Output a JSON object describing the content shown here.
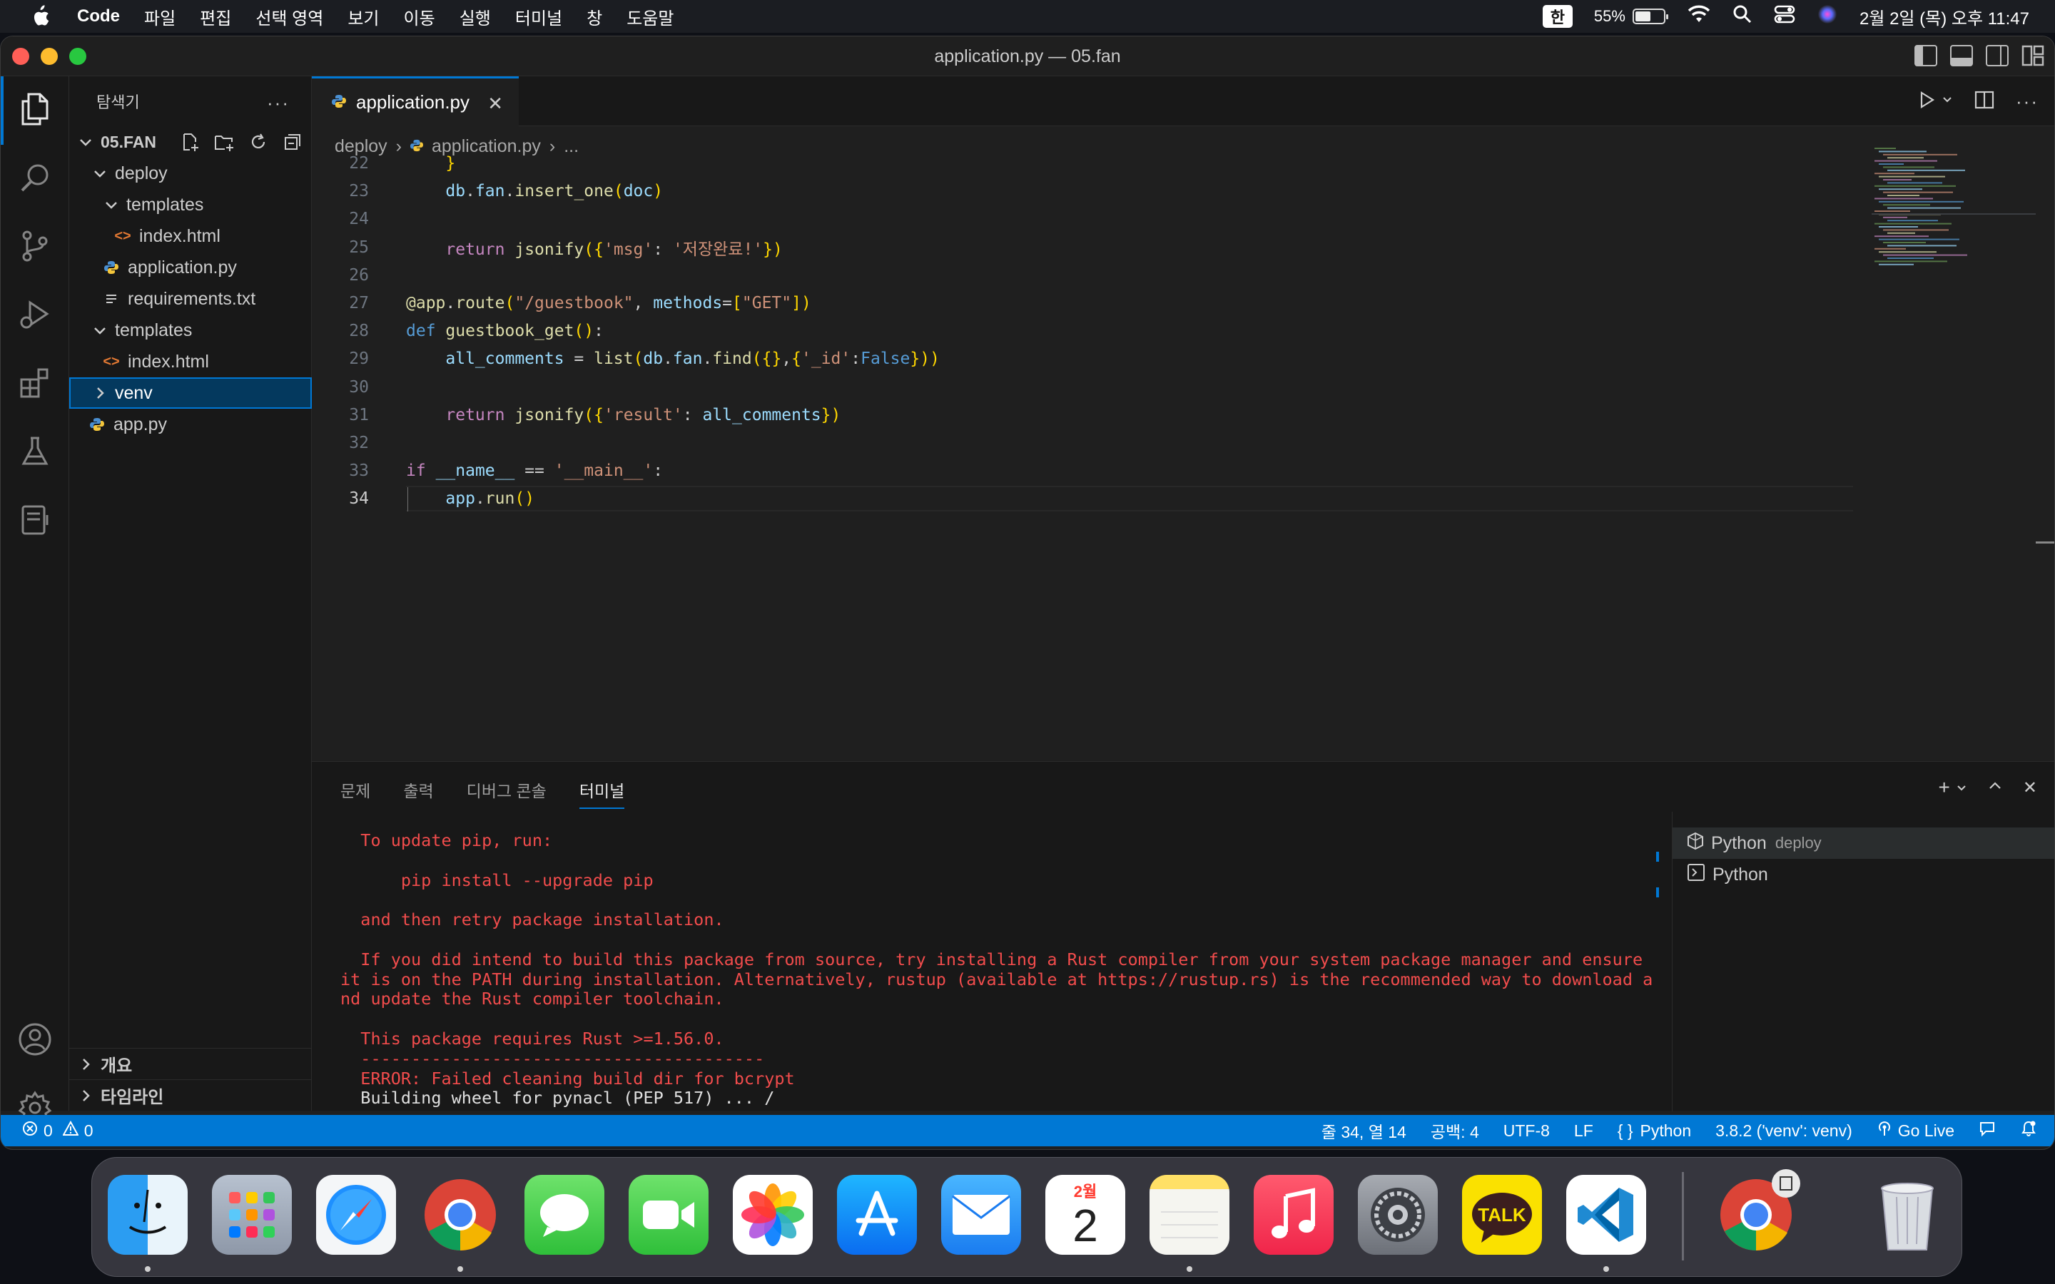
{
  "menubar": {
    "app_name": "Code",
    "menus": [
      "파일",
      "편집",
      "선택 영역",
      "보기",
      "이동",
      "실행",
      "터미널",
      "창",
      "도움말"
    ],
    "input_source": "한",
    "battery_percent": "55%",
    "battery_level": 0.55,
    "datetime": "2월 2일 (목) 오후 11:47"
  },
  "window": {
    "title": "application.py — 05.fan"
  },
  "sidebar": {
    "header": "탐색기",
    "more": "···",
    "root": "05.FAN",
    "tree": [
      {
        "label": "deploy",
        "type": "folder",
        "expanded": true
      },
      {
        "label": "templates",
        "type": "folder",
        "expanded": true
      },
      {
        "label": "index.html",
        "type": "html"
      },
      {
        "label": "application.py",
        "type": "python"
      },
      {
        "label": "requirements.txt",
        "type": "text"
      },
      {
        "label": "templates",
        "type": "folder",
        "expanded": true
      },
      {
        "label": "index.html",
        "type": "html"
      },
      {
        "label": "venv",
        "type": "folder",
        "expanded": false,
        "selected": true
      },
      {
        "label": "app.py",
        "type": "python"
      }
    ],
    "outline": "개요",
    "timeline": "타임라인"
  },
  "editor": {
    "tab_label": "application.py",
    "breadcrumb": [
      "deploy",
      "application.py",
      "..."
    ],
    "lines": [
      {
        "n": "22",
        "text": "    }"
      },
      {
        "n": "23",
        "text": "    db.fan.insert_one(doc)"
      },
      {
        "n": "24",
        "text": ""
      },
      {
        "n": "25",
        "text": "    return jsonify({'msg': '저장완료!'})"
      },
      {
        "n": "26",
        "text": ""
      },
      {
        "n": "27",
        "text": "@app.route(\"/guestbook\", methods=[\"GET\"])"
      },
      {
        "n": "28",
        "text": "def guestbook_get():"
      },
      {
        "n": "29",
        "text": "    all_comments = list(db.fan.find({},{'_id':False}))"
      },
      {
        "n": "30",
        "text": ""
      },
      {
        "n": "31",
        "text": "    return jsonify({'result': all_comments})"
      },
      {
        "n": "32",
        "text": ""
      },
      {
        "n": "33",
        "text": "if __name__ == '__main__':"
      },
      {
        "n": "34",
        "text": "    app.run()"
      }
    ]
  },
  "panel": {
    "tabs": [
      "문제",
      "출력",
      "디버그 콘솔",
      "터미널"
    ],
    "active_tab": "터미널",
    "terminal_lines": [
      {
        "text": "  To update pip, run:",
        "color": "red"
      },
      {
        "text": "",
        "color": "red"
      },
      {
        "text": "      pip install --upgrade pip",
        "color": "red"
      },
      {
        "text": "",
        "color": "red"
      },
      {
        "text": "  and then retry package installation.",
        "color": "red"
      },
      {
        "text": "",
        "color": "red"
      },
      {
        "text": "  If you did intend to build this package from source, try installing a Rust compiler from your system package manager and ensure",
        "color": "red"
      },
      {
        "text": "it is on the PATH during installation. Alternatively, rustup (available at https://rustup.rs) is the recommended way to download a",
        "color": "red"
      },
      {
        "text": "nd update the Rust compiler toolchain.",
        "color": "red"
      },
      {
        "text": "",
        "color": "red"
      },
      {
        "text": "  This package requires Rust >=1.56.0.",
        "color": "red"
      },
      {
        "text": "  ----------------------------------------",
        "color": "red"
      },
      {
        "text": "  ERROR: Failed cleaning build dir for bcrypt",
        "color": "red"
      },
      {
        "text": "  Building wheel for pynacl (PEP 517) ... /",
        "color": "white"
      }
    ],
    "terminals": [
      {
        "name": "Python",
        "desc": "deploy"
      },
      {
        "name": "Python",
        "desc": ""
      }
    ]
  },
  "statusbar": {
    "errors": "0",
    "warnings": "0",
    "position": "줄 34, 열 14",
    "spaces": "공백: 4",
    "encoding": "UTF-8",
    "eol": "LF",
    "language": "Python",
    "interpreter": "3.8.2 ('venv': venv)",
    "golive": "Go Live"
  },
  "dock": {
    "calendar_month": "2월",
    "calendar_day": "2",
    "talk_label": "TALK"
  },
  "colors": {
    "accent": "#0078d4",
    "terminal_error": "#f14c4c"
  }
}
